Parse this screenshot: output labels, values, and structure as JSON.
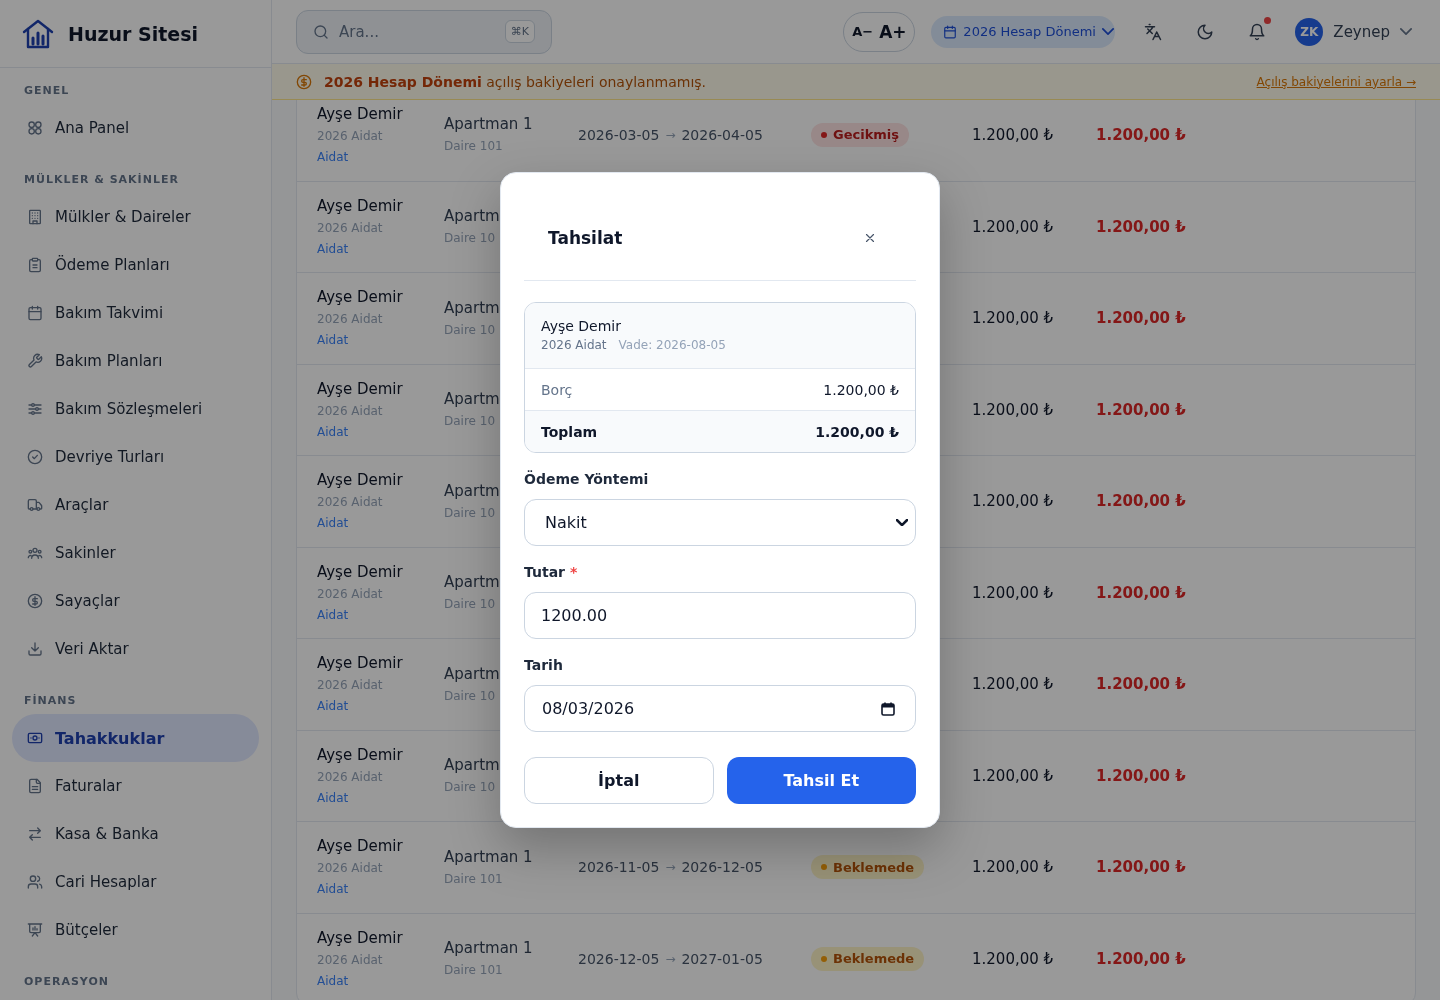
{
  "sidebar": {
    "brand": "Huzur Sitesi",
    "sections": [
      {
        "title": "GENEL",
        "items": [
          {
            "label": "Ana Panel",
            "selected": false
          }
        ]
      },
      {
        "title": "MÜLKLER & SAKİNLER",
        "items": [
          {
            "label": "Mülkler & Daireler",
            "selected": false
          },
          {
            "label": "Ödeme Planları",
            "selected": false
          },
          {
            "label": "Bakım Takvimi",
            "selected": false
          },
          {
            "label": "Bakım Planları",
            "selected": false
          },
          {
            "label": "Bakım Sözleşmeleri",
            "selected": false
          },
          {
            "label": "Devriye Turları",
            "selected": false
          },
          {
            "label": "Araçlar",
            "selected": false
          },
          {
            "label": "Sakinler",
            "selected": false
          },
          {
            "label": "Sayaçlar",
            "selected": false
          },
          {
            "label": "Veri Aktar",
            "selected": false
          }
        ]
      },
      {
        "title": "FİNANS",
        "items": [
          {
            "label": "Tahakkuklar",
            "selected": true
          },
          {
            "label": "Faturalar",
            "selected": false
          },
          {
            "label": "Kasa & Banka",
            "selected": false
          },
          {
            "label": "Cari Hesaplar",
            "selected": false
          },
          {
            "label": "Bütçeler",
            "selected": false
          }
        ]
      },
      {
        "title": "OPERASYON"
      }
    ]
  },
  "topbar": {
    "search": {
      "placeholder": "Ara...",
      "shortcut": "⌘K"
    },
    "font_size_buttons": [
      {
        "label": "A−",
        "kind": "decrease"
      },
      {
        "label": "A+",
        "kind": "increase"
      }
    ],
    "period": "2026 Hesap Dönemi",
    "notifications": {
      "unread": true
    },
    "user": {
      "initials": "ZK",
      "name": "Zeynep"
    }
  },
  "banner": {
    "message": "**2026 Hesap Dönemi** açılış bakiyeleri onaylanmamış.",
    "link": "Açılış bakiyelerini ayarla →"
  },
  "table": {
    "rows": [
      {
        "resident": "Ayşe Demir",
        "plan": "2026 Aidat",
        "type": "Aidat",
        "building": "Apartman 1",
        "unit": "Daire 101",
        "period": {
          "start": "2026-03-05",
          "arrow": "→",
          "end": "2026-04-05"
        },
        "status": {
          "label": "Gecikmiş",
          "kind": "overdue"
        },
        "amount": "1.200,00 ₺",
        "remaining": "1.200,00 ₺"
      },
      {
        "resident": "Ayşe Demir",
        "plan": "2026 Aidat",
        "type": "Aidat",
        "building": "Apartm",
        "unit": "Daire 10",
        "amount": "1.200,00 ₺",
        "remaining": "1.200,00 ₺"
      },
      {
        "resident": "Ayşe Demir",
        "plan": "2026 Aidat",
        "type": "Aidat",
        "building": "Apartm",
        "unit": "Daire 10",
        "amount": "1.200,00 ₺",
        "remaining": "1.200,00 ₺"
      },
      {
        "resident": "Ayşe Demir",
        "plan": "2026 Aidat",
        "type": "Aidat",
        "building": "Apartm",
        "unit": "Daire 10",
        "amount": "1.200,00 ₺",
        "remaining": "1.200,00 ₺"
      },
      {
        "resident": "Ayşe Demir",
        "plan": "2026 Aidat",
        "type": "Aidat",
        "building": "Apartm",
        "unit": "Daire 10",
        "amount": "1.200,00 ₺",
        "remaining": "1.200,00 ₺"
      },
      {
        "resident": "Ayşe Demir",
        "plan": "2026 Aidat",
        "type": "Aidat",
        "building": "Apartm",
        "unit": "Daire 10",
        "amount": "1.200,00 ₺",
        "remaining": "1.200,00 ₺"
      },
      {
        "resident": "Ayşe Demir",
        "plan": "2026 Aidat",
        "type": "Aidat",
        "building": "Apartm",
        "unit": "Daire 10",
        "amount": "1.200,00 ₺",
        "remaining": "1.200,00 ₺"
      },
      {
        "resident": "Ayşe Demir",
        "plan": "2026 Aidat",
        "type": "Aidat",
        "building": "Apartm",
        "unit": "Daire 10",
        "amount": "1.200,00 ₺",
        "remaining": "1.200,00 ₺"
      },
      {
        "resident": "Ayşe Demir",
        "plan": "2026 Aidat",
        "type": "Aidat",
        "building": "Apartman 1",
        "unit": "Daire 101",
        "period": {
          "start": "2026-11-05",
          "arrow": "→",
          "end": "2026-12-05"
        },
        "status": {
          "label": "Beklemede",
          "kind": "pending"
        },
        "amount": "1.200,00 ₺",
        "remaining": "1.200,00 ₺"
      },
      {
        "resident": "Ayşe Demir",
        "plan": "2026 Aidat",
        "type": "Aidat",
        "building": "Apartman 1",
        "unit": "Daire 101",
        "period": {
          "start": "2026-12-05",
          "arrow": "→",
          "end": "2027-01-05"
        },
        "status": {
          "label": "Beklemede",
          "kind": "pending"
        },
        "amount": "1.200,00 ₺",
        "remaining": "1.200,00 ₺"
      }
    ]
  },
  "modal": {
    "title": "Tahsilat",
    "summary": {
      "resident": "Ayşe Demir",
      "plan": "2026 Aidat",
      "due": "Vade: 2026-08-05",
      "lines": [
        {
          "label": "Borç",
          "value": "1.200,00 ₺",
          "kind": "line"
        },
        {
          "label": "Toplam",
          "value": "1.200,00 ₺",
          "kind": "total"
        }
      ]
    },
    "fields": [
      {
        "kind": "select",
        "label": "Ödeme Yöntemi",
        "value": "Nakit"
      },
      {
        "kind": "text",
        "label": "Tutar",
        "required_mark": "*",
        "value": "1200.00"
      },
      {
        "kind": "date",
        "label": "Tarih",
        "value": "08/03/2026"
      }
    ],
    "buttons": [
      {
        "label": "İptal",
        "kind": "secondary"
      },
      {
        "label": "Tahsil Et",
        "kind": "primary"
      }
    ]
  }
}
